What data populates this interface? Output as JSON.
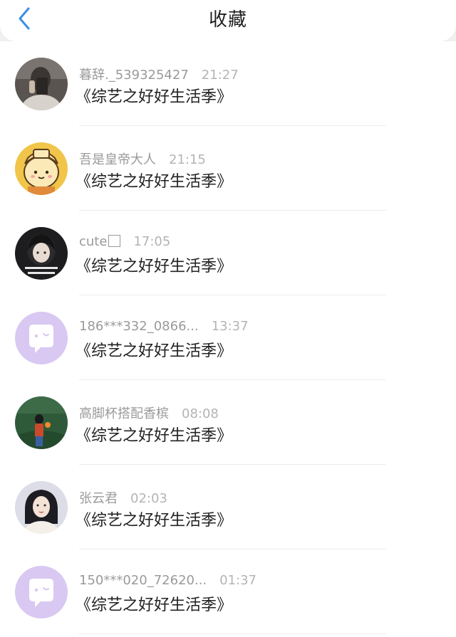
{
  "header": {
    "title": "收藏",
    "back_icon": "chevron-left-icon",
    "accent_color": "#3b8ee8"
  },
  "items": [
    {
      "username": "暮辞._539325427",
      "time": "21:27",
      "content": "《综艺之好好生活季》",
      "avatar": "photo-mirror-selfie"
    },
    {
      "username": "吾是皇帝大人",
      "time": "21:15",
      "content": "《综艺之好好生活季》",
      "avatar": "cartoon-yellow-character"
    },
    {
      "username": "cute",
      "time": "17:05",
      "content": "《综艺之好好生活季》",
      "avatar": "photo-girl-with-caption"
    },
    {
      "username": "186***332_0866...",
      "time": "13:37",
      "content": "《综艺之好好生活季》",
      "avatar": "default-chat-bubble"
    },
    {
      "username": "高脚杯搭配香槟",
      "time": "08:08",
      "content": "《综艺之好好生活季》",
      "avatar": "photo-girl-field"
    },
    {
      "username": "张云君",
      "time": "02:03",
      "content": "《综艺之好好生活季》",
      "avatar": "photo-woman-portrait"
    },
    {
      "username": "150***020_72620...",
      "time": "01:37",
      "content": "《综艺之好好生活季》",
      "avatar": "default-chat-bubble"
    }
  ],
  "colors": {
    "default_avatar_bg": "#d9c8f2",
    "username": "#9a9a9a",
    "content": "#222222"
  }
}
